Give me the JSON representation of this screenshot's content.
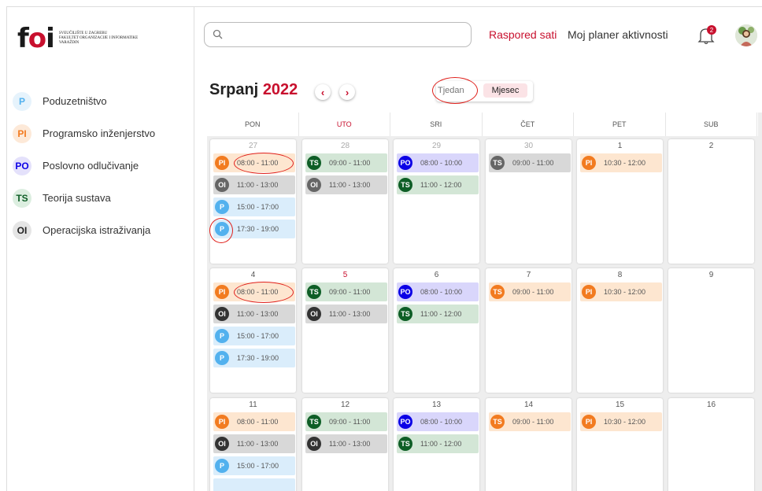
{
  "logo": {
    "text_f": "f",
    "text_o": "o",
    "text_i": "i",
    "subtitle_l1": "SVEUČILIŠTE U ZAGREBU",
    "subtitle_l2": "FAKULTET ORGANIZACIJE I INFORMATIKE",
    "subtitle_l3": "VARAŽDIN"
  },
  "subjects": [
    {
      "abbr": "P",
      "label": "Poduzetništvo",
      "color": "#52b1ee",
      "bg": "#e6f3fc"
    },
    {
      "abbr": "PI",
      "label": "Programsko inženjerstvo",
      "color": "#f27b20",
      "bg": "#fde9d8"
    },
    {
      "abbr": "PO",
      "label": "Poslovno odlučivanje",
      "color": "#0c00e6",
      "bg": "#e4e1fb"
    },
    {
      "abbr": "TS",
      "label": "Teorija sustava",
      "color": "#0e5e26",
      "bg": "#dceee0"
    },
    {
      "abbr": "OI",
      "label": "Operacijska istraživanja",
      "color": "#222222",
      "bg": "#e5e5e5"
    }
  ],
  "search": {
    "placeholder": ""
  },
  "nav": {
    "schedule": "Raspored sati",
    "planner": "Moj planer aktivnosti"
  },
  "notifications": {
    "count": "2"
  },
  "calendar": {
    "month": "Srpanj",
    "year": "2022",
    "view_week": "Tjedan",
    "view_month": "Mjesec",
    "days_of_week": [
      "PON",
      "UTO",
      "SRI",
      "ČET",
      "PET",
      "SUB"
    ],
    "week1": [
      "27",
      "28",
      "29",
      "30",
      "1",
      "2"
    ],
    "week2": [
      "4",
      "5",
      "6",
      "7",
      "8",
      "9"
    ],
    "week3": [
      "11",
      "12",
      "13",
      "14",
      "15",
      "16"
    ],
    "events": {
      "mon_pi": "08:00 - 11:00",
      "mon_oi": "11:00 - 13:00",
      "mon_p1": "15:00 - 17:00",
      "mon_p2": "17:30 - 19:00",
      "tue_ts": "09:00 - 11:00",
      "tue_oi": "11:00 - 13:00",
      "wed_po": "08:00 - 10:00",
      "wed_ts": "11:00 - 12:00",
      "thu_ts": "09:00 - 11:00",
      "fri_pi": "10:30 - 12:00"
    }
  },
  "colors": {
    "accent": "#c8102e",
    "annotation": "#e0201b"
  }
}
